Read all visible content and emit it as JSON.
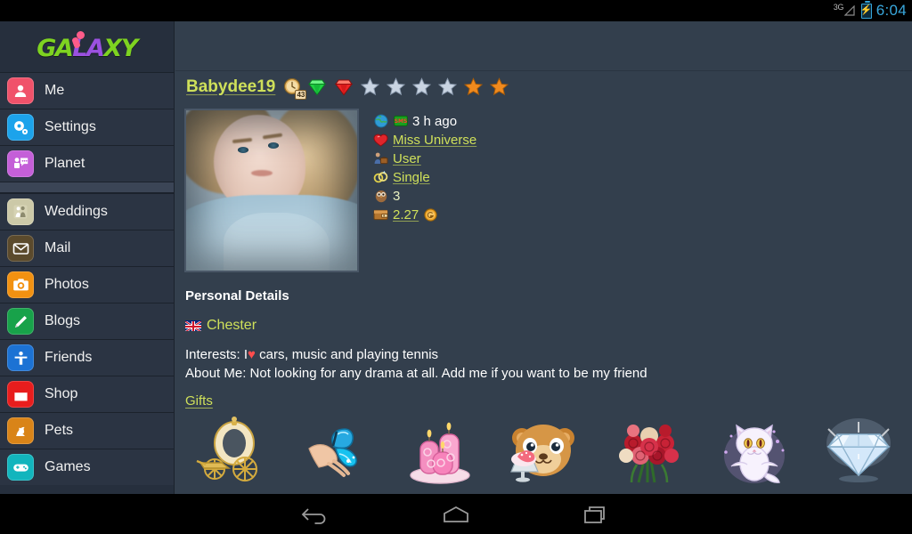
{
  "statusbar": {
    "network": "3G",
    "battery_icon": "battery-charging-icon",
    "time": "6:04"
  },
  "sidebar": {
    "logo_text": "GALAXY",
    "logo_part1": "GA",
    "logo_part2": "LA",
    "logo_part3": "XY",
    "items": [
      {
        "label": "Me",
        "icon": "person-icon",
        "color": "#f0526a"
      },
      {
        "label": "Settings",
        "icon": "gear-icon",
        "color": "#1ca3eb"
      },
      {
        "label": "Planet",
        "icon": "chat-icon",
        "color": "#c45fd8"
      },
      {
        "label": "Weddings",
        "icon": "couple-icon",
        "color": "#ccc9a8"
      },
      {
        "label": "Mail",
        "icon": "envelope-icon",
        "color": "#5b4a2c"
      },
      {
        "label": "Photos",
        "icon": "camera-icon",
        "color": "#f29111"
      },
      {
        "label": "Blogs",
        "icon": "pencil-icon",
        "color": "#18a24a"
      },
      {
        "label": "Friends",
        "icon": "friends-icon",
        "color": "#1c72d4"
      },
      {
        "label": "Shop",
        "icon": "bag-icon",
        "color": "#e81d1d"
      },
      {
        "label": "Pets",
        "icon": "pet-icon",
        "color": "#d98418"
      },
      {
        "label": "Games",
        "icon": "gamepad-icon",
        "color": "#12b5bd"
      }
    ]
  },
  "profile": {
    "username": "Babydee19",
    "clock_badge_count": "43",
    "badges": [
      "clock-badge-icon",
      "green-diamond-icon",
      "red-diamond-icon"
    ],
    "stars": {
      "silver": 4,
      "gold": 2,
      "total": 6
    },
    "photo_alt": "profile-photo",
    "details": [
      {
        "icon": "globe-sms-icon",
        "text": "3 h ago",
        "link": true,
        "extra_icon": "sms-icon"
      },
      {
        "icon": "red-heart-icon",
        "text": "Miss Universe",
        "link": true
      },
      {
        "icon": "job-icon",
        "text": "User",
        "link": true
      },
      {
        "icon": "rings-icon",
        "text": "Single",
        "link": true
      },
      {
        "icon": "owl-icon",
        "text": "3",
        "link": false
      },
      {
        "icon": "wallet-icon",
        "text": "2.27",
        "link": true,
        "extra_icon": "gold-coin-icon"
      }
    ]
  },
  "personal": {
    "title": "Personal Details",
    "flag": "uk-flag-icon",
    "location": "Chester",
    "interests_label": "Interests: I",
    "interests_heart": "♥",
    "interests_text": " cars, music and playing tennis",
    "about_text": "About Me: Not looking for any drama at all. Add me if you want to be my friend",
    "gifts_link": "Gifts"
  },
  "gifts": [
    {
      "name": "golden-carriage-gift"
    },
    {
      "name": "blue-butterfly-gift"
    },
    {
      "name": "pink-candles-gift"
    },
    {
      "name": "teddy-bear-sundae-gift"
    },
    {
      "name": "rose-bouquet-gift"
    },
    {
      "name": "white-cat-gift"
    },
    {
      "name": "diamond-gift"
    }
  ],
  "navbar": {
    "back": "back-icon",
    "home": "home-icon",
    "recents": "recents-icon"
  },
  "colors": {
    "accent": "#cfe05a",
    "sidebar_bg": "#262f3d",
    "content_bg": "#333f4d",
    "status_text": "#39a8dd"
  }
}
